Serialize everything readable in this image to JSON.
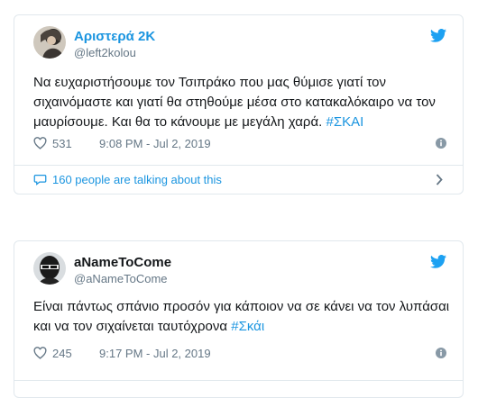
{
  "tweets": [
    {
      "display_name": "Αριστερά 2K",
      "handle": "@left2kolou",
      "text": "Να ευχαριστήσουμε τον Τσιπράκο που μας θύμισε γιατί τον σιχαινόμαστε και γιατί θα στηθούμε μέσα στο κατακαλόκαιρο να τον μαυρίσουμε. Και θα το κάνουμε με μεγάλη χαρά.",
      "hashtag": "#ΣΚΑΙ",
      "likes": "531",
      "timestamp": "9:08 PM - Jul 2, 2019",
      "talking": "160 people are talking about this"
    },
    {
      "display_name": "aNameToCome",
      "handle": "@aNameToCome",
      "text": "Είναι πάντως σπάνιο προσόν για κάποιον να σε κάνει να τον λυπάσαι και να τον σιχαίνεται ταυτόχρονα",
      "hashtag": "#Σκάι",
      "likes": "245",
      "timestamp": "9:17 PM - Jul 2, 2019"
    }
  ],
  "colors": {
    "link": "#1b95e0",
    "muted": "#657786",
    "border": "#e1e8ed",
    "text": "#14171a"
  },
  "icons": [
    "twitter-bird-icon",
    "heart-icon",
    "info-icon",
    "comment-bubble-icon",
    "chevron-right-icon"
  ]
}
